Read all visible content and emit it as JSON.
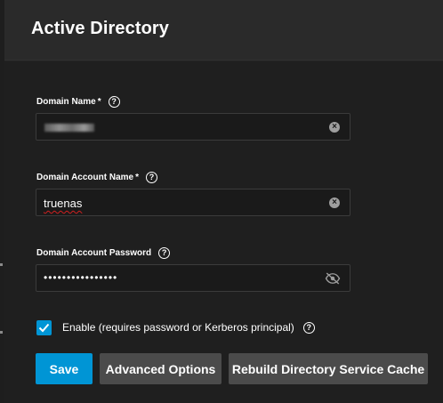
{
  "dialog": {
    "title": "Active Directory"
  },
  "form": {
    "domain_name": {
      "label": "Domain Name",
      "required_marker": "*",
      "help_glyph": "?",
      "value_redacted": true
    },
    "domain_account_name": {
      "label": "Domain Account Name",
      "required_marker": "*",
      "help_glyph": "?",
      "value": "truenas"
    },
    "domain_account_password": {
      "label": "Domain Account Password",
      "help_glyph": "?",
      "masked_value": "••••••••••••••••"
    },
    "enable": {
      "label": "Enable (requires password or Kerberos principal)",
      "checked": true,
      "help_glyph": "?"
    }
  },
  "actions": {
    "save_label": "Save",
    "advanced_label": "Advanced Options",
    "rebuild_label": "Rebuild Directory Service Cache"
  },
  "icons": {
    "clear": "clear-icon",
    "visibility_off": "eye-off-icon",
    "help": "help-icon",
    "check": "check-icon"
  },
  "colors": {
    "accent": "#0095d5",
    "secondary_button": "#4b4b4b",
    "panel_bg": "#1f1f1f"
  }
}
